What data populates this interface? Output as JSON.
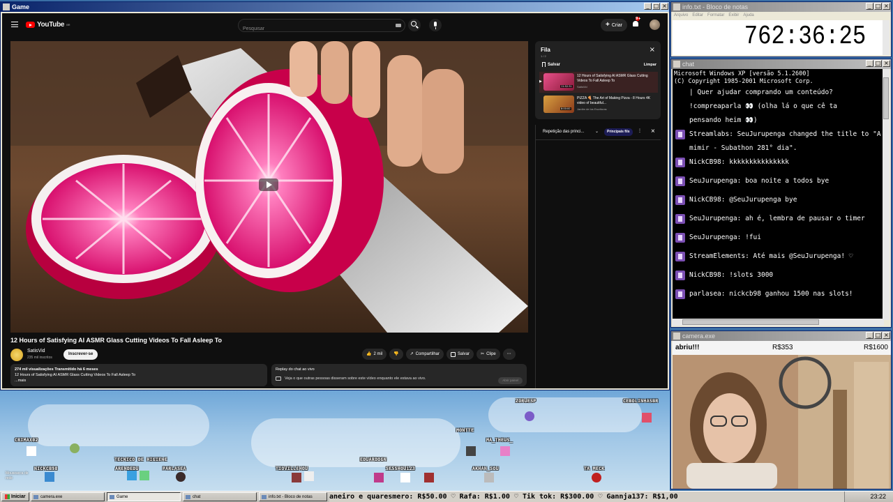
{
  "windows": {
    "game": {
      "title": "Game"
    },
    "notepad": {
      "title": "info.txt - Bloco de notas",
      "menu": [
        "Arquivo",
        "Editar",
        "Formatar",
        "Exibir",
        "Ajuda"
      ],
      "content": "762:36:25"
    },
    "chat": {
      "title": "chat"
    },
    "camera": {
      "title": "camera.exe"
    }
  },
  "youtube": {
    "logo": "YouTube",
    "logo_country": "BR",
    "search_placeholder": "Pesquisar",
    "create_label": "Criar",
    "notification_count": "9+",
    "video": {
      "title": "12 Hours of Satisfying AI ASMR Glass Cutting Videos To Fall Asleep To",
      "channel": "SatisVid",
      "subscribers": "235 mil inscritos",
      "subscribe_label": "Inscrever-se",
      "likes": "2 mil",
      "share_label": "Compartilhar",
      "save_label": "Salvar",
      "clip_label": "Clipe",
      "views": "274 mil visualizações",
      "streamed": "Transmitido há 6 meses",
      "desc_line": "12 Hours of Satisfying AI ASMR Glass Cutting Videos To Fall Asleep To",
      "more": "...mais"
    },
    "replay": {
      "title": "Replay do chat ao vivo",
      "subtitle": "Veja o que outras pessoas disseram sobre este vídeo enquanto ele estava ao vivo.",
      "open_label": "Abrir painel"
    },
    "queue": {
      "title": "Fila",
      "count": "1 / 2",
      "save_label": "Salvar",
      "clear_label": "Limpar",
      "items": [
        {
          "title": "12 Hours of Satisfying AI ASMR Glass Cutting Videos To Fall Asleep To",
          "channel": "SatisVid",
          "duration": "11:52:31"
        },
        {
          "title": "PIZZA 🍕 The Art of Making Pizza - 8 Hours 4K video of beautiful...",
          "channel": "Jardim de los Escrituras",
          "duration": "8:00:00"
        }
      ]
    },
    "chat_replay": {
      "label": "Repetição das princi...",
      "badge": "Principais fils"
    }
  },
  "game_players": [
    {
      "name": "ZORUESP"
    },
    {
      "name": "CEBOLINHASBR"
    },
    {
      "name": "MONTTE"
    },
    {
      "name": "MA_THEUS_"
    },
    {
      "name": "CRIMAX02"
    },
    {
      "name": "TECNICO DE HIGIENE"
    },
    {
      "name": "ARENDEDU"
    },
    {
      "name": "PARLASEA"
    },
    {
      "name": "NICKCB98"
    },
    {
      "name": "TIOVILLEHOU"
    },
    {
      "name": "EDUARDOGN"
    },
    {
      "name": "SE5SHOU123"
    },
    {
      "name": "AKHAN_SOU"
    },
    {
      "name": "TA MECK"
    }
  ],
  "mouse_label": "Mouseacca de rede",
  "chat": {
    "header": [
      "Microsoft Windows XP [versão 5.1.2600]",
      "(C) Copyright 1985-2001 Microsoft Corp."
    ],
    "pinned": [
      "| Quer ajudar comprando um conteúdo?",
      "!compreaparla 👀 (olha lá o que cê ta",
      "pensando heim 👀)"
    ],
    "messages": [
      {
        "user": "Streamlabs",
        "text": "SeuJurupenga changed the title to \"A mimir - Subathon 281° dia\"."
      },
      {
        "user": "NickCB98",
        "text": "kkkkkkkkkkkkkkk"
      },
      {
        "user": "SeuJurupenga",
        "text": "boa noite a todos bye"
      },
      {
        "user": "NickCB98",
        "text": "@SeuJurupenga bye"
      },
      {
        "user": "SeuJurupenga",
        "text": "ah é, lembra de pausar o timer"
      },
      {
        "user": "SeuJurupenga",
        "text": "!fui"
      },
      {
        "user": "StreamElements",
        "text": "Até mais @SeuJurupenga! ♡"
      },
      {
        "user": "NickCB98",
        "text": "!slots 3000"
      },
      {
        "user": "parlasea",
        "text": "nickcb98 ganhou 1500 nas slots!"
      }
    ]
  },
  "camera": {
    "label": "abriu!!!",
    "amount1": "R$353",
    "amount2": "R$1600"
  },
  "taskbar": {
    "start": "Iniciar",
    "tasks": [
      "camera.exe",
      "Game",
      "chat",
      "info.txt - Bloco de notas"
    ],
    "ticker": "aneiro e quaresmero: R$50.00 ♡ Rafa: R$1.00 ♡ Tik tok: R$300.00 ♡ Gannja137: R$1,00",
    "clock": "23:22"
  },
  "colors": {
    "yt_bg": "#0f0f0f",
    "yt_red": "#ff0000",
    "xp_title": "#0a246a",
    "money_green": "#1a8a1a"
  }
}
